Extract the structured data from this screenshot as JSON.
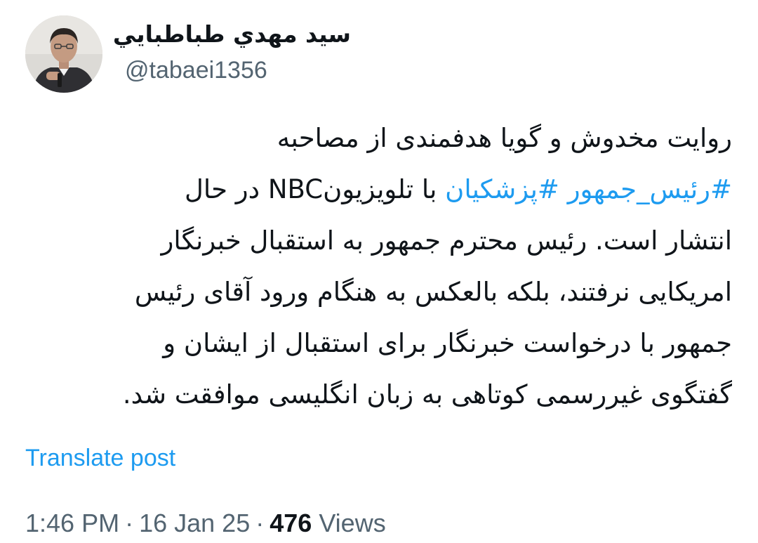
{
  "author": {
    "display_name": "سيد مهدي طباطبايي",
    "handle": "@tabaei1356",
    "avatar_icon": "profile-photo"
  },
  "tweet": {
    "lines": [
      [
        {
          "text": "روایت مخدوش و گویا هدفمندی از مصاحبه",
          "hashtag": false
        }
      ],
      [
        {
          "text": "#رئیس_جمهور",
          "hashtag": true
        },
        {
          "text": " ",
          "hashtag": false
        },
        {
          "text": "#پزشکیان",
          "hashtag": true
        },
        {
          "text": " با تلویزیونNBC در حال",
          "hashtag": false
        }
      ],
      [
        {
          "text": "انتشار است. رئیس محترم جمهور به استقبال خبرنگار",
          "hashtag": false
        }
      ],
      [
        {
          "text": "امریکایی نرفتند، بلکه بالعکس به هنگام ورود آقای رئیس",
          "hashtag": false
        }
      ],
      [
        {
          "text": "جمهور با درخواست خبرنگار برای استقبال از ایشان و",
          "hashtag": false
        }
      ],
      [
        {
          "text": "گفتگوی غیررسمی کوتاهی به زبان انگلیسی موافقت شد.",
          "hashtag": false
        }
      ]
    ]
  },
  "translate_label": "Translate post",
  "meta": {
    "time": "1:46 PM",
    "separator": "·",
    "date": "16 Jan 25",
    "views_count": "476",
    "views_label": "Views"
  },
  "colors": {
    "text": "#0f1419",
    "secondary": "#536471",
    "link": "#1d9bf0"
  }
}
